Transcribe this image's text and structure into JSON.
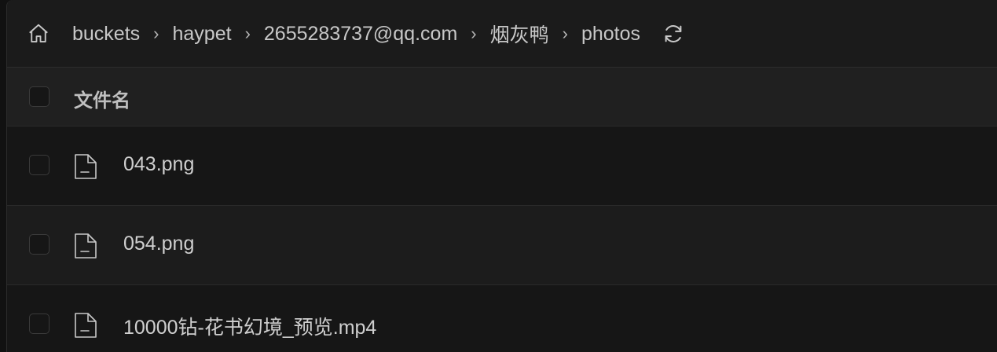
{
  "breadcrumb": {
    "home_icon": "home-icon",
    "items": [
      "buckets",
      "haypet",
      "2655283737@qq.com",
      "烟灰鸭",
      "photos"
    ],
    "separator": "›",
    "refresh_icon": "refresh-icon"
  },
  "table": {
    "header": {
      "name_label": "文件名"
    },
    "rows": [
      {
        "name": "043.png",
        "icon": "file-icon"
      },
      {
        "name": "054.png",
        "icon": "file-icon"
      },
      {
        "name": "10000钻-花书幻境_预览.mp4",
        "icon": "file-icon"
      }
    ]
  },
  "colors": {
    "background": "#1a1a1a",
    "header_bg": "#202020",
    "text": "#cfcfcf"
  }
}
